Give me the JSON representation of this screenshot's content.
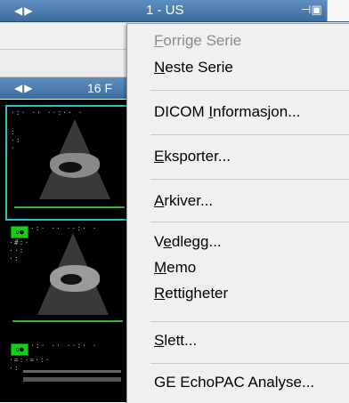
{
  "header": {
    "title": "1 - US"
  },
  "panel": {
    "title": "16 F"
  },
  "menu": {
    "items": [
      {
        "id": "forrige-serie",
        "pre": "",
        "acc": "F",
        "post": "orrige Serie",
        "disabled": true
      },
      {
        "id": "neste-serie",
        "pre": "",
        "acc": "N",
        "post": "este Serie",
        "disabled": false
      },
      {
        "id": "dicom-informasjon",
        "pre": "DICOM ",
        "acc": "I",
        "post": "nformasjon...",
        "disabled": false
      },
      {
        "id": "eksporter",
        "pre": "",
        "acc": "E",
        "post": "ksporter...",
        "disabled": false
      },
      {
        "id": "arkiver",
        "pre": "",
        "acc": "A",
        "post": "rkiver...",
        "disabled": false
      },
      {
        "id": "vedlegg",
        "pre": "V",
        "acc": "e",
        "post": "dlegg...",
        "disabled": false
      },
      {
        "id": "memo",
        "pre": "",
        "acc": "M",
        "post": "emo",
        "disabled": false
      },
      {
        "id": "rettigheter",
        "pre": "",
        "acc": "R",
        "post": "ettigheter",
        "disabled": false
      },
      {
        "id": "slett",
        "pre": "",
        "acc": "S",
        "post": "lett...",
        "disabled": false
      },
      {
        "id": "ge-echopac",
        "pre": "GE EchoPAC Analyse...",
        "acc": "",
        "post": "",
        "disabled": false
      }
    ]
  },
  "colors": {
    "header": "#4a7aab",
    "selection": "#1ec8c8",
    "badge": "#16d016",
    "menu_bg": "#f0f0f0",
    "disabled_text": "#8b8b8b"
  },
  "icons": {
    "nav": "left-right-arrows-icon",
    "pin": "pin-icon"
  }
}
